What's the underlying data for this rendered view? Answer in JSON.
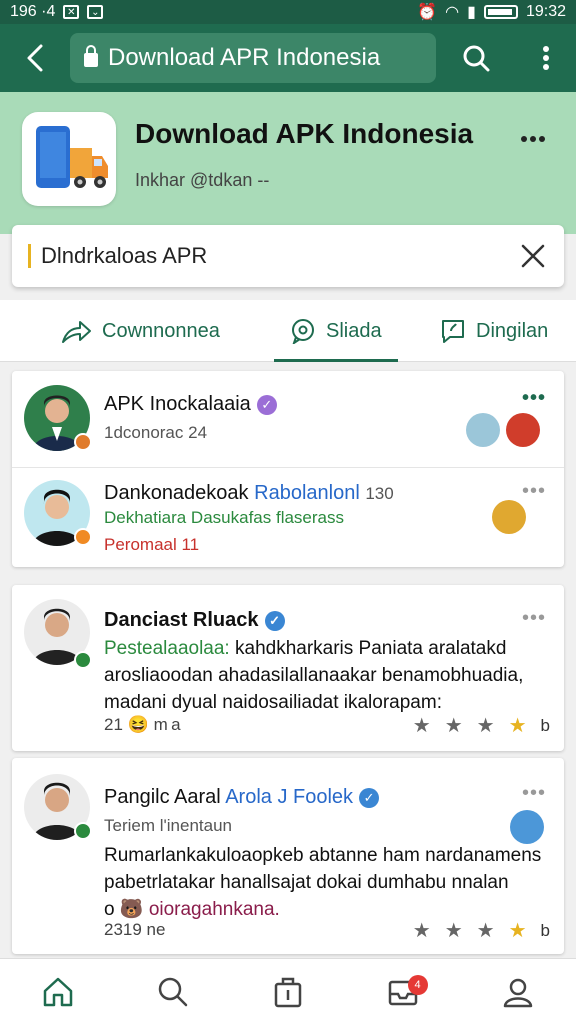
{
  "status_bar": {
    "left_text": "196 ·4",
    "time": "19:32"
  },
  "app_bar": {
    "url": "Download APR Indonesia"
  },
  "header": {
    "title": "Download APK Indonesia",
    "subtitle": "Inkhar @tdkan  --"
  },
  "search": {
    "value": "Dlndrkaloas APR"
  },
  "tabs": [
    {
      "label": "Cownnonnea"
    },
    {
      "label": "Sliada"
    },
    {
      "label": "Dingilan"
    }
  ],
  "card1": {
    "row1": {
      "name": "APK Inockalaaia",
      "sub": "1dconorac 24"
    },
    "row2": {
      "name": "Dankonadekoak",
      "name_link": "Rabolanlonl",
      "count": "130",
      "line2": "Dekhatiara Dasukafas flaserass",
      "line3": "Peromaal 11"
    }
  },
  "post1": {
    "name": "Danciast Rluack",
    "lead": "Pestealaaolaa:",
    "body_1": "kahdkharkaris Paniata aralatakd",
    "body_2": "arosliaoodan ahadasilallanaakar benamobhuadia,",
    "body_3": "madani dyual naidosailiadat ikalorapam:",
    "meta_left": "21",
    "meta_right": "m a",
    "rating_suffix": "b"
  },
  "post2": {
    "name": "Pangilc Aaral",
    "name_link": "Arola J Foolek",
    "sub": "Teriem l'inentaun",
    "body_1": "Rumarlankakuloaopkeb abtanne ham nardanamens",
    "body_2": "pabetrlatakar hanallsajat dokai dumhabu nnalan",
    "body_3_prefix": "o",
    "body_3": "oioragahnkana.",
    "meta": "2319 ne",
    "rating_suffix": "b"
  },
  "nav": {
    "badge": "4"
  },
  "colors": {
    "primary": "#1f6b4f",
    "header_bg": "#a9dbb8",
    "accent": "#e7b321"
  }
}
